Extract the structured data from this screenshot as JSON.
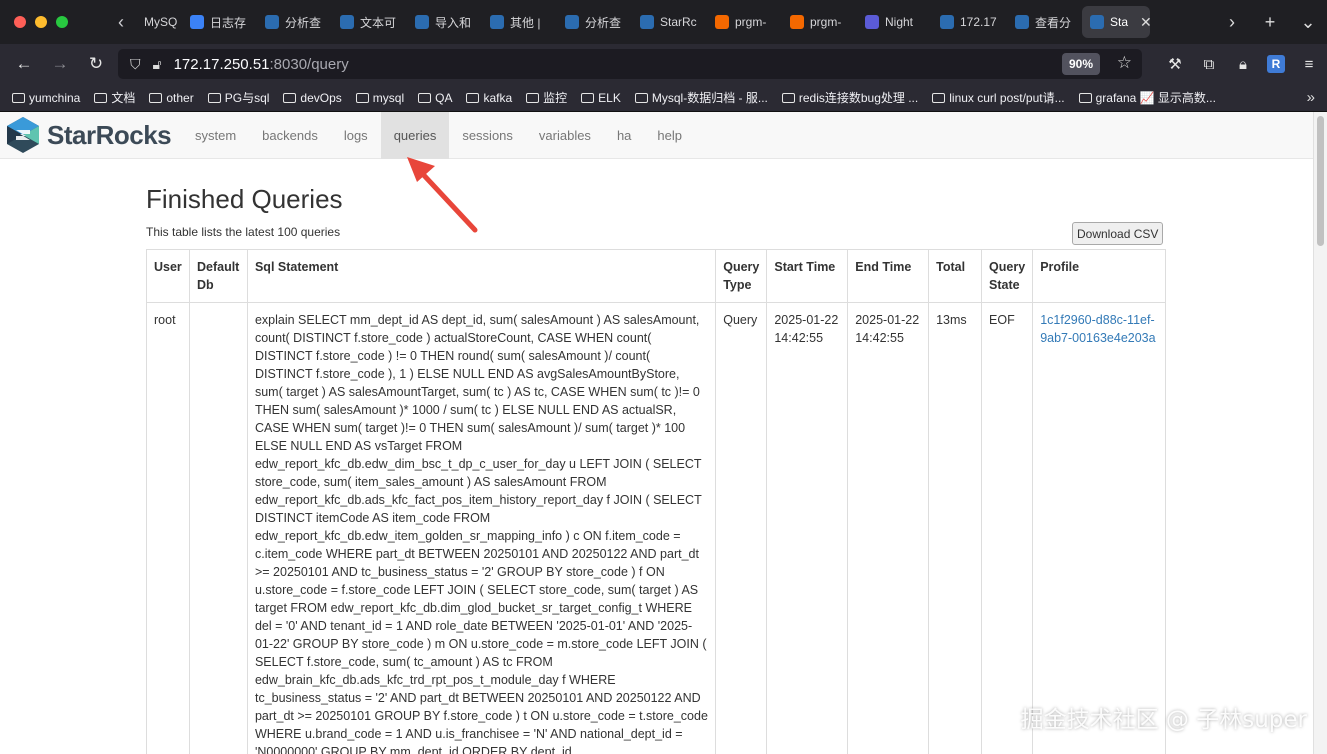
{
  "browser": {
    "tabs": [
      {
        "label": "MySQ",
        "color": "#4b8bbe"
      },
      {
        "label": "日志存",
        "color": "#3b82f6"
      },
      {
        "label": "分析查",
        "color": "#2b6cb0"
      },
      {
        "label": "文本可",
        "color": "#2b6cb0"
      },
      {
        "label": "导入和",
        "color": "#2b6cb0"
      },
      {
        "label": "其他 |",
        "color": "#2b6cb0"
      },
      {
        "label": "分析查",
        "color": "#2b6cb0"
      },
      {
        "label": "StarRc",
        "color": "#2b6cb0"
      },
      {
        "label": "prgm-",
        "color": "#f46800"
      },
      {
        "label": "prgm-",
        "color": "#f46800"
      },
      {
        "label": "Night",
        "color": "#5b5bd6"
      },
      {
        "label": "172.17",
        "color": "#2b6cb0"
      },
      {
        "label": "查看分",
        "color": "#2b6cb0"
      },
      {
        "label": "Sta",
        "color": "#2b6cb0",
        "active": true
      }
    ],
    "url_host": "172.17.250.51",
    "url_path": ":8030/query",
    "zoom": "90%",
    "extension_badge": "R",
    "bookmarks": [
      "yumchina",
      "文档",
      "other",
      "PG与sql",
      "devOps",
      "mysql",
      "QA",
      "kafka",
      "监控",
      "ELK",
      "Mysql-数据归档 - 服...",
      "redis连接数bug处理 ...",
      "linux curl post/put请...",
      "grafana 📈 显示高数..."
    ]
  },
  "app": {
    "brand": "StarRocks",
    "nav": [
      "system",
      "backends",
      "logs",
      "queries",
      "sessions",
      "variables",
      "ha",
      "help"
    ],
    "active_nav": "queries"
  },
  "main": {
    "title": "Finished Queries",
    "subtitle": "This table lists the latest 100 queries",
    "download_label": "Download CSV",
    "columns": [
      "User",
      "Default Db",
      "Sql Statement",
      "Query Type",
      "Start Time",
      "End Time",
      "Total",
      "Query State",
      "Profile"
    ],
    "rows": [
      {
        "user": "root",
        "default_db": "",
        "sql": "explain SELECT mm_dept_id AS dept_id, sum( salesAmount ) AS salesAmount, count( DISTINCT f.store_code ) actualStoreCount, CASE WHEN count( DISTINCT f.store_code ) != 0 THEN round( sum( salesAmount )/ count( DISTINCT f.store_code ), 1 ) ELSE NULL END AS avgSalesAmountByStore, sum( target ) AS salesAmountTarget, sum( tc ) AS tc, CASE WHEN sum( tc )!= 0 THEN sum( salesAmount )* 1000 / sum( tc ) ELSE NULL END AS actualSR, CASE WHEN sum( target )!= 0 THEN sum( salesAmount )/ sum( target )* 100 ELSE NULL END AS vsTarget FROM edw_report_kfc_db.edw_dim_bsc_t_dp_c_user_for_day u LEFT JOIN ( SELECT store_code, sum( item_sales_amount ) AS salesAmount FROM edw_report_kfc_db.ads_kfc_fact_pos_item_history_report_day f JOIN ( SELECT DISTINCT itemCode AS item_code FROM edw_report_kfc_db.edw_item_golden_sr_mapping_info ) c ON f.item_code = c.item_code WHERE part_dt BETWEEN 20250101 AND 20250122 AND part_dt >= 20250101 AND tc_business_status = '2' GROUP BY store_code ) f ON u.store_code = f.store_code LEFT JOIN ( SELECT store_code, sum( target ) AS target FROM edw_report_kfc_db.dim_glod_bucket_sr_target_config_t WHERE del = '0' AND tenant_id = 1 AND role_date BETWEEN '2025-01-01' AND '2025-01-22' GROUP BY store_code ) m ON u.store_code = m.store_code LEFT JOIN ( SELECT f.store_code, sum( tc_amount ) AS tc FROM edw_brain_kfc_db.ads_kfc_trd_rpt_pos_t_module_day f WHERE tc_business_status = '2' AND part_dt BETWEEN 20250101 AND 20250122 AND part_dt >= 20250101 GROUP BY f.store_code ) t ON u.store_code = t.store_code WHERE u.brand_code = 1 AND u.is_franchisee = 'N' AND national_dept_id = 'N0000000' GROUP BY mm_dept_id ORDER BY dept_id",
        "query_type": "Query",
        "start_time": "2025-01-22 14:42:55",
        "end_time": "2025-01-22 14:42:55",
        "total": "13ms",
        "state": "EOF",
        "profile": "1c1f2960-d88c-11ef-9ab7-00163e4e203a"
      }
    ]
  },
  "watermark": "掘金技术社区 @ 子林super"
}
